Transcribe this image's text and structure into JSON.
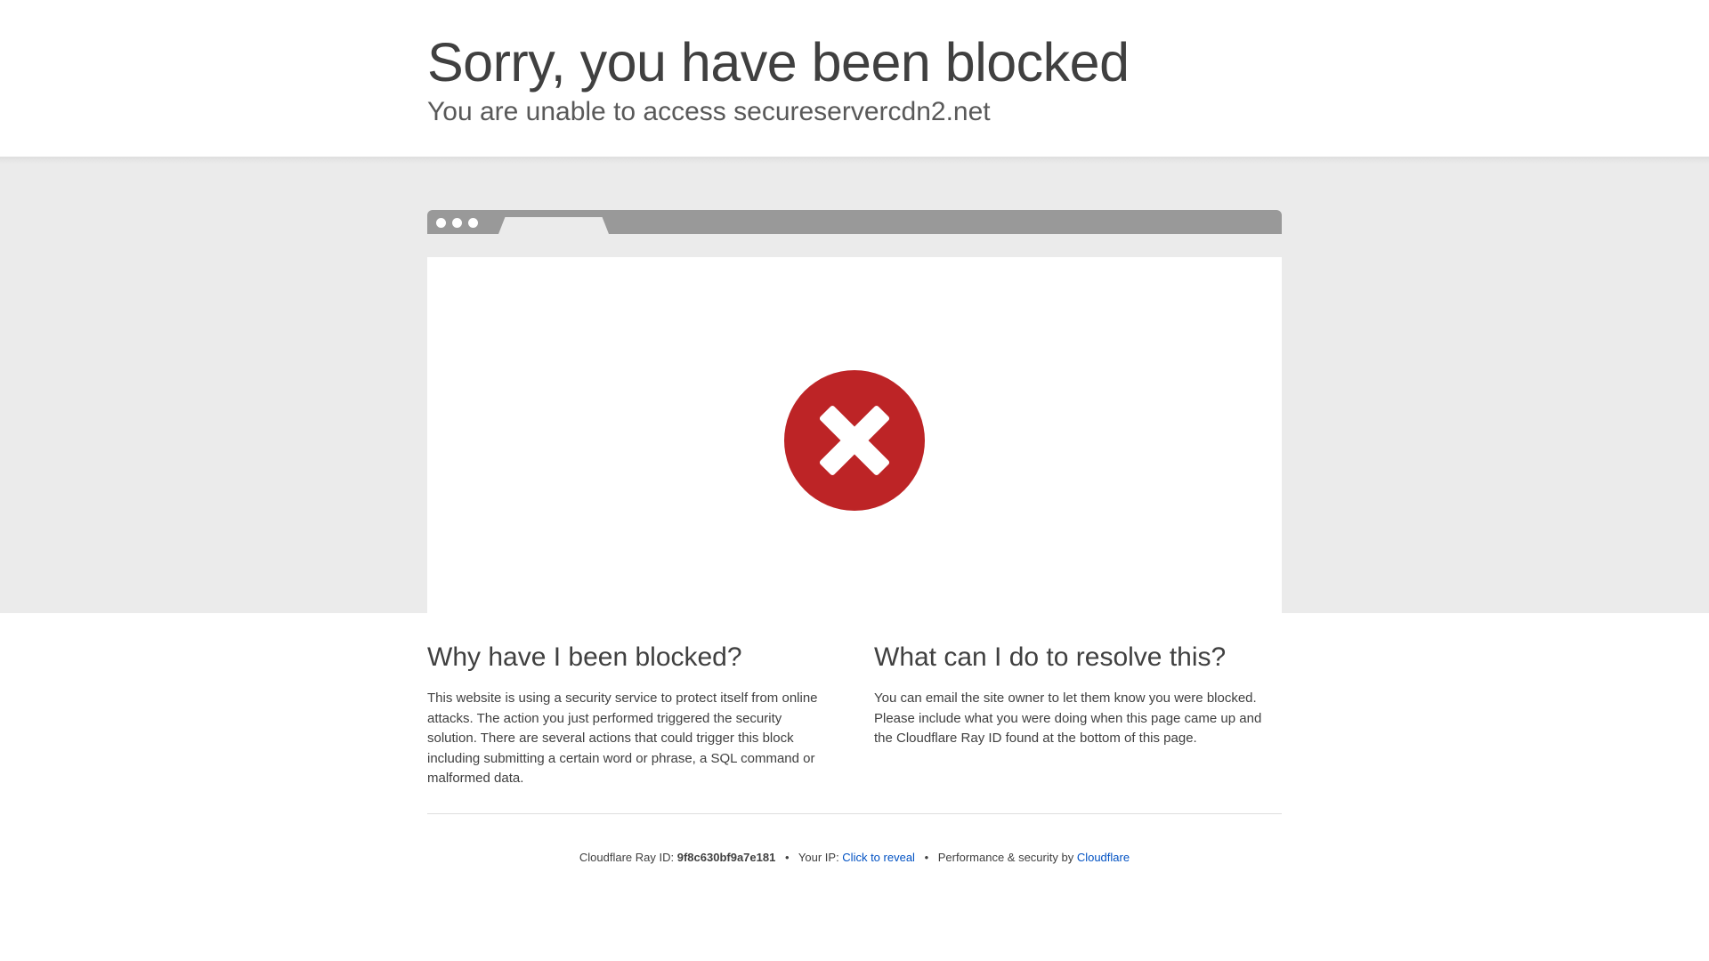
{
  "header": {
    "title": "Sorry, you have been blocked",
    "subtitle": "You are unable to access secureservercdn2.net"
  },
  "browser_illustration": {
    "icon": "error-x-icon",
    "colors": {
      "icon_fill": "#bd2426",
      "bar": "#999999",
      "band": "#ebebeb"
    }
  },
  "why": {
    "heading": "Why have I been blocked?",
    "body": "This website is using a security service to protect itself from online attacks. The action you just performed triggered the security solution. There are several actions that could trigger this block including submitting a certain word or phrase, a SQL command or malformed data."
  },
  "resolve": {
    "heading": "What can I do to resolve this?",
    "body": "You can email the site owner to let them know you were blocked. Please include what you were doing when this page came up and the Cloudflare Ray ID found at the bottom of this page."
  },
  "footer": {
    "ray_label": "Cloudflare Ray ID: ",
    "ray_id": "9f8c630bf9a7e181",
    "separator": "•",
    "ip_label": "Your IP: ",
    "ip_link": "Click to reveal",
    "perf_label": "Performance & security by ",
    "cloudflare_link": "Cloudflare",
    "link_color": "#0051c3"
  }
}
